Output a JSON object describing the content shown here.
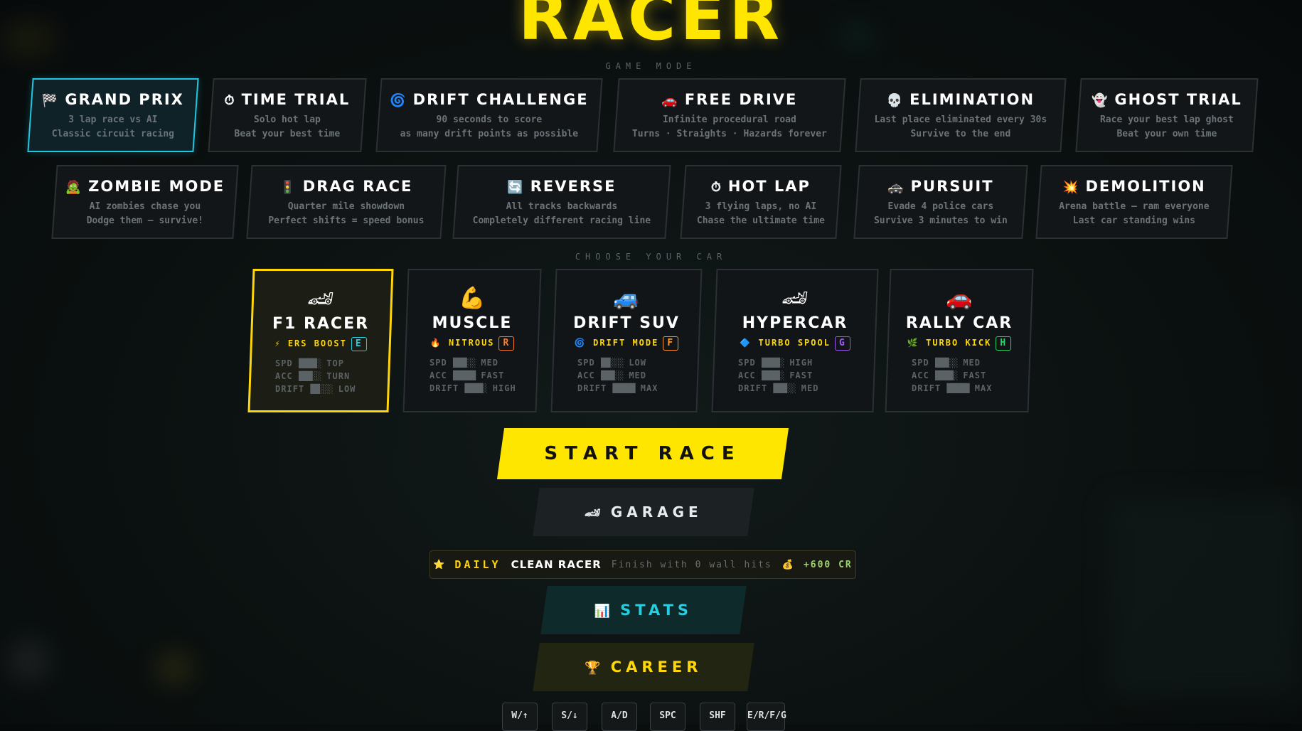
{
  "title": "RACER",
  "game_mode_label": "GAME MODE",
  "choose_car_label": "CHOOSE YOUR CAR",
  "modes": [
    {
      "icon": "🏁",
      "title": "GRAND PRIX",
      "line1": "3 lap race vs AI",
      "line2": "Classic circuit racing",
      "active": true
    },
    {
      "icon": "⏱",
      "title": "TIME TRIAL",
      "line1": "Solo hot lap",
      "line2": "Beat your best time",
      "active": false
    },
    {
      "icon": "🌀",
      "title": "DRIFT CHALLENGE",
      "line1": "90 seconds to score",
      "line2": "as many drift points as possible",
      "active": false
    },
    {
      "icon": "🚗",
      "title": "FREE DRIVE",
      "line1": "Infinite procedural road",
      "line2": "Turns · Straights · Hazards forever",
      "active": false
    },
    {
      "icon": "💀",
      "title": "ELIMINATION",
      "line1": "Last place eliminated every 30s",
      "line2": "Survive to the end",
      "active": false
    },
    {
      "icon": "👻",
      "title": "GHOST TRIAL",
      "line1": "Race your best lap ghost",
      "line2": "Beat your own time",
      "active": false
    },
    {
      "icon": "🧟",
      "title": "ZOMBIE MODE",
      "line1": "AI zombies chase you",
      "line2": "Dodge them — survive!",
      "active": false
    },
    {
      "icon": "🚦",
      "title": "DRAG RACE",
      "line1": "Quarter mile showdown",
      "line2": "Perfect shifts = speed bonus",
      "active": false
    },
    {
      "icon": "🔄",
      "title": "REVERSE",
      "line1": "All tracks backwards",
      "line2": "Completely different racing line",
      "active": false
    },
    {
      "icon": "⏱",
      "title": "HOT LAP",
      "line1": "3 flying laps, no AI",
      "line2": "Chase the ultimate time",
      "active": false
    },
    {
      "icon": "🚓",
      "title": "PURSUIT",
      "line1": "Evade 4 police cars",
      "line2": "Survive 3 minutes to win",
      "active": false
    },
    {
      "icon": "💥",
      "title": "DEMOLITION",
      "line1": "Arena battle — ram everyone",
      "line2": "Last car standing wins",
      "active": false
    }
  ],
  "cars": [
    {
      "icon": "🏎",
      "name": "F1 RACER",
      "ability_icon": "⚡",
      "ability": "ERS BOOST",
      "key": "E",
      "key_color": "#24cde0",
      "active": true,
      "stats": [
        {
          "label": "SPD",
          "bar": "████░",
          "rating": "TOP"
        },
        {
          "label": "ACC",
          "bar": "███░░",
          "rating": "TURN"
        },
        {
          "label": "DRIFT",
          "bar": "██░░░",
          "rating": "LOW"
        }
      ]
    },
    {
      "icon": "💪",
      "name": "MUSCLE",
      "ability_icon": "🔥",
      "ability": "NITROUS",
      "key": "R",
      "key_color": "#ff7a2a",
      "active": false,
      "stats": [
        {
          "label": "SPD",
          "bar": "███░░",
          "rating": "MED"
        },
        {
          "label": "ACC",
          "bar": "█████",
          "rating": "FAST"
        },
        {
          "label": "DRIFT",
          "bar": "████░",
          "rating": "HIGH"
        }
      ]
    },
    {
      "icon": "🚙",
      "name": "DRIFT SUV",
      "ability_icon": "🌀",
      "ability": "DRIFT MODE",
      "key": "F",
      "key_color": "#ff9a2a",
      "active": false,
      "stats": [
        {
          "label": "SPD",
          "bar": "██░░░",
          "rating": "LOW"
        },
        {
          "label": "ACC",
          "bar": "███░░",
          "rating": "MED"
        },
        {
          "label": "DRIFT",
          "bar": "█████",
          "rating": "MAX"
        }
      ]
    },
    {
      "icon": "🏎",
      "name": "HYPERCAR",
      "ability_icon": "🔷",
      "ability": "TURBO SPOOL",
      "key": "G",
      "key_color": "#a05af0",
      "active": false,
      "stats": [
        {
          "label": "SPD",
          "bar": "████░",
          "rating": "HIGH"
        },
        {
          "label": "ACC",
          "bar": "████░",
          "rating": "FAST"
        },
        {
          "label": "DRIFT",
          "bar": "███░░",
          "rating": "MED"
        }
      ]
    },
    {
      "icon": "🚗",
      "name": "RALLY CAR",
      "ability_icon": "🌿",
      "ability": "TURBO KICK",
      "key": "H",
      "key_color": "#2ed36a",
      "active": false,
      "stats": [
        {
          "label": "SPD",
          "bar": "███░░",
          "rating": "MED"
        },
        {
          "label": "ACC",
          "bar": "████░",
          "rating": "FAST"
        },
        {
          "label": "DRIFT",
          "bar": "█████",
          "rating": "MAX"
        }
      ]
    }
  ],
  "buttons": {
    "start": "START RACE",
    "garage_icon": "🏎",
    "garage": "GARAGE",
    "stats_icon": "📊",
    "stats": "STATS",
    "career_icon": "🏆",
    "career": "CAREER"
  },
  "daily": {
    "icon": "⭐",
    "label": "DAILY",
    "name": "CLEAN RACER",
    "desc": "Finish with 0 wall hits",
    "reward_icon": "💰",
    "reward": "+600 CR"
  },
  "keys": [
    "W/↑",
    "S/↓",
    "A/D",
    "SPC",
    "SHF",
    "E/R/F/G"
  ]
}
